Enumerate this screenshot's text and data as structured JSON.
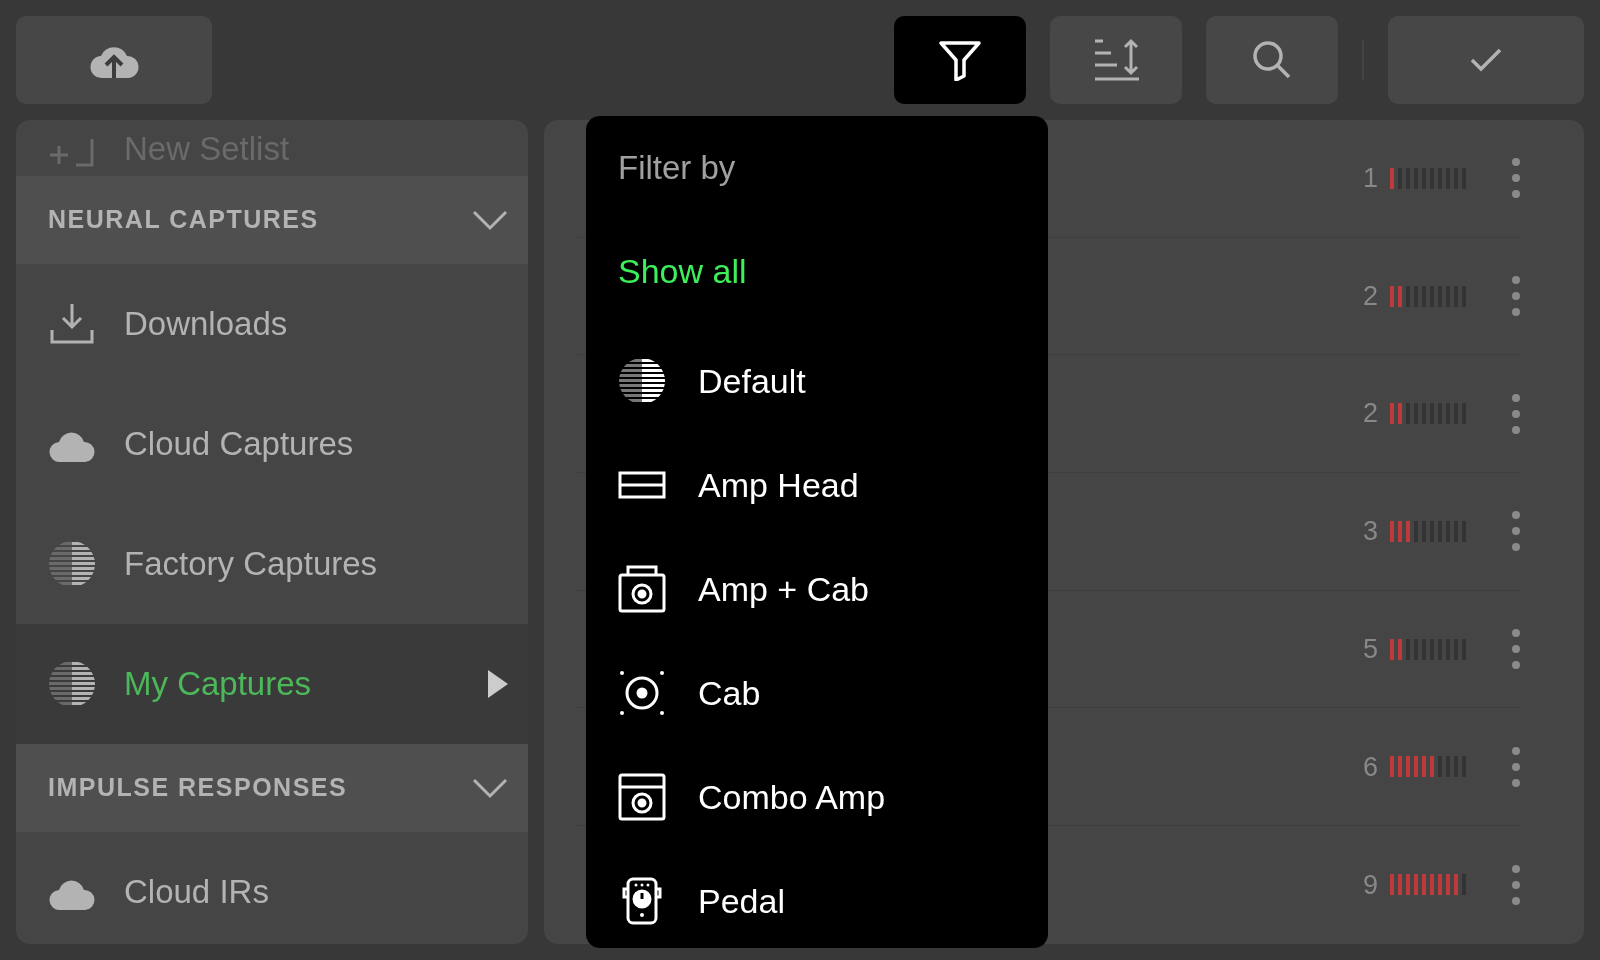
{
  "toolbar": {
    "buttons": [
      {
        "kind": "upload",
        "selected": false
      },
      {
        "kind": "filter",
        "selected": true
      },
      {
        "kind": "sort",
        "selected": false
      },
      {
        "kind": "search",
        "selected": false
      },
      {
        "kind": "confirm",
        "selected": false
      }
    ]
  },
  "sidebar": {
    "partial_item": {
      "label": "New Setlist"
    },
    "sections": [
      {
        "title": "NEURAL CAPTURES",
        "expanded": true,
        "items": [
          {
            "label": "Downloads",
            "kind": "download",
            "selected": false
          },
          {
            "label": "Cloud Captures",
            "kind": "cloud",
            "selected": false
          },
          {
            "label": "Factory Captures",
            "kind": "stripes",
            "selected": false
          },
          {
            "label": "My Captures",
            "kind": "stripes",
            "selected": true
          }
        ]
      },
      {
        "title": "IMPULSE RESPONSES",
        "expanded": true,
        "items": [
          {
            "label": "Cloud IRs",
            "kind": "cloud",
            "selected": false
          }
        ]
      }
    ]
  },
  "list": {
    "rows": [
      {
        "count": "1",
        "level": 0.1
      },
      {
        "count": "2",
        "level": 0.2
      },
      {
        "count": "2",
        "level": 0.2
      },
      {
        "count": "3",
        "level": 0.3
      },
      {
        "count": "5",
        "level": 0.2
      },
      {
        "count": "6",
        "level": 0.6
      },
      {
        "count": "9",
        "level": 0.9
      }
    ]
  },
  "filter_menu": {
    "title": "Filter by",
    "show_all": {
      "label": "Show all",
      "selected": true
    },
    "options": [
      {
        "label": "Default",
        "kind": "default",
        "selected": false
      },
      {
        "label": "Amp Head",
        "kind": "amp_head",
        "selected": false
      },
      {
        "label": "Amp + Cab",
        "kind": "amp_cab",
        "selected": false
      },
      {
        "label": "Cab",
        "kind": "cab",
        "selected": false
      },
      {
        "label": "Combo Amp",
        "kind": "combo",
        "selected": false
      },
      {
        "label": "Pedal",
        "kind": "pedal",
        "selected": false
      }
    ]
  }
}
